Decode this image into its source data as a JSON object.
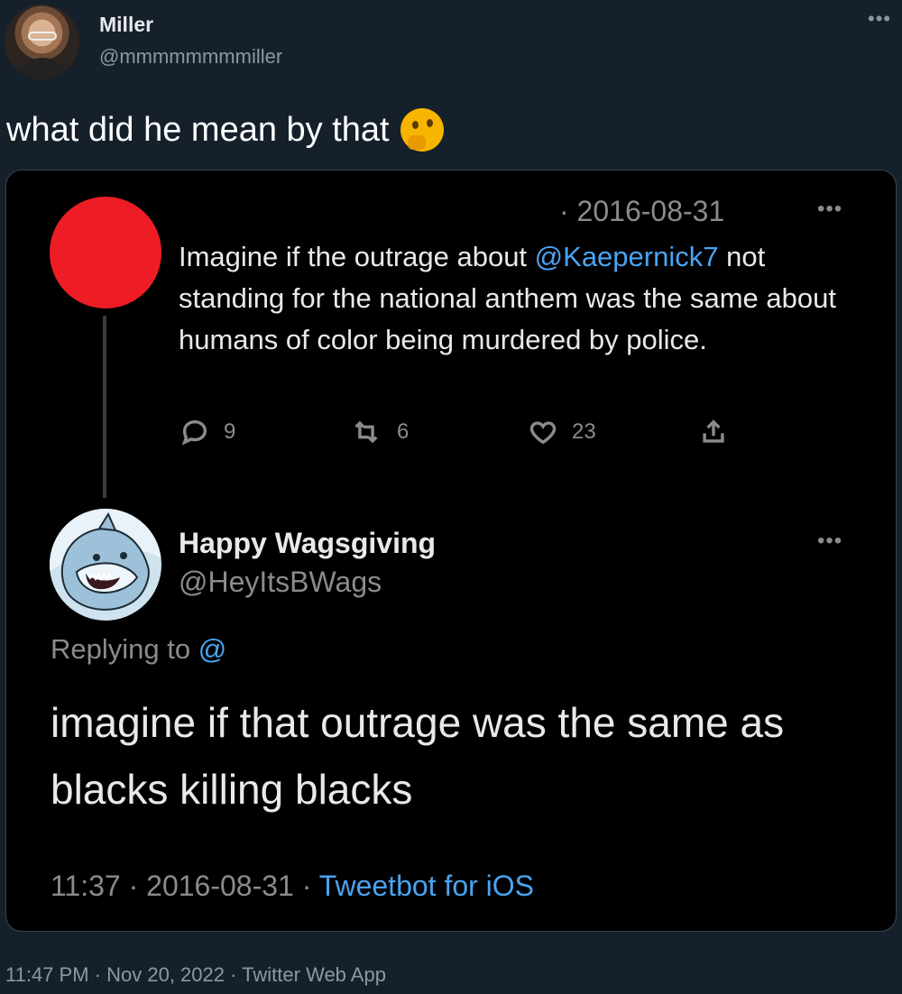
{
  "outer_tweet": {
    "name": "Miller",
    "handle": "@mmmmmmmmiller",
    "more": "•••",
    "text": "what did he mean by that",
    "emoji": "thinking-face",
    "meta": {
      "time": "11:47 PM",
      "sep1": "·",
      "date": "Nov 20, 2022",
      "sep2": "·",
      "client": "Twitter Web App"
    }
  },
  "quoted": {
    "first_tweet": {
      "avatar_color": "#ee1c25",
      "date": "· 2016-08-31",
      "more": "•••",
      "text_before": "Imagine if the outrage about ",
      "mention": "@Kaepernick7",
      "text_after": " not standing for the national anthem was the same about humans of color being murdered by police.",
      "actions": {
        "replies": "9",
        "retweets": "6",
        "likes": "23"
      }
    },
    "reply_tweet": {
      "name": "Happy Wagsgiving",
      "handle": "@HeyItsBWags",
      "more": "•••",
      "replying_label": "Replying to ",
      "replying_mention": "@",
      "text": "imagine if that outrage was the same as blacks killing blacks",
      "meta": {
        "time": "11:37",
        "sep1": " · ",
        "date": "2016-08-31",
        "sep2": " · ",
        "client": "Tweetbot for iOS"
      }
    }
  },
  "colors": {
    "background": "#15202b",
    "card": "#000000",
    "link": "#4aa3f0",
    "muted": "#8b98a5"
  }
}
